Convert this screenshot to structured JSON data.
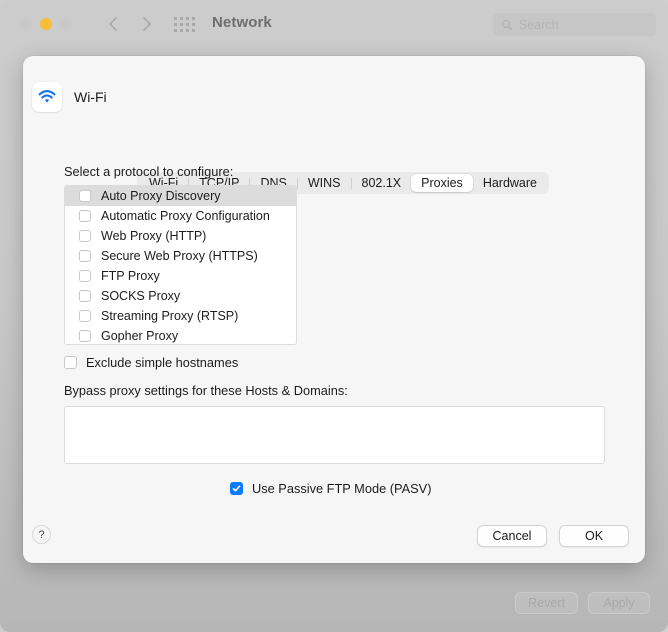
{
  "window": {
    "title": "Network",
    "traffic_lights": [
      {
        "name": "close",
        "color": "#c9c9c9"
      },
      {
        "name": "minimize",
        "color": "#f8bd34"
      },
      {
        "name": "zoom",
        "color": "#c9c9c9"
      }
    ],
    "search": {
      "placeholder": "Search"
    },
    "background_buttons": [
      {
        "label": "Revert"
      },
      {
        "label": "Apply"
      }
    ]
  },
  "sheet": {
    "service": {
      "name": "Wi-Fi",
      "icon": "wifi-icon",
      "accent": "#1271ee"
    },
    "tabs": [
      {
        "label": "Wi-Fi",
        "selected": false
      },
      {
        "label": "TCP/IP",
        "selected": false
      },
      {
        "label": "DNS",
        "selected": false
      },
      {
        "label": "WINS",
        "selected": false
      },
      {
        "label": "802.1X",
        "selected": false
      },
      {
        "label": "Proxies",
        "selected": true
      },
      {
        "label": "Hardware",
        "selected": false
      }
    ],
    "protocol_section": {
      "label": "Select a protocol to configure:",
      "items": [
        {
          "label": "Auto Proxy Discovery",
          "checked": false,
          "selected": true
        },
        {
          "label": "Automatic Proxy Configuration",
          "checked": false,
          "selected": false
        },
        {
          "label": "Web Proxy (HTTP)",
          "checked": false,
          "selected": false
        },
        {
          "label": "Secure Web Proxy (HTTPS)",
          "checked": false,
          "selected": false
        },
        {
          "label": "FTP Proxy",
          "checked": false,
          "selected": false
        },
        {
          "label": "SOCKS Proxy",
          "checked": false,
          "selected": false
        },
        {
          "label": "Streaming Proxy (RTSP)",
          "checked": false,
          "selected": false
        },
        {
          "label": "Gopher Proxy",
          "checked": false,
          "selected": false
        }
      ]
    },
    "exclude_simple_hostnames": {
      "label": "Exclude simple hostnames",
      "checked": false
    },
    "bypass": {
      "label": "Bypass proxy settings for these Hosts & Domains:",
      "value": ""
    },
    "passive_ftp": {
      "label": "Use Passive FTP Mode (PASV)",
      "checked": true,
      "checked_color": "#0a7bff"
    },
    "footer": {
      "help_label": "?",
      "cancel_label": "Cancel",
      "ok_label": "OK"
    }
  }
}
